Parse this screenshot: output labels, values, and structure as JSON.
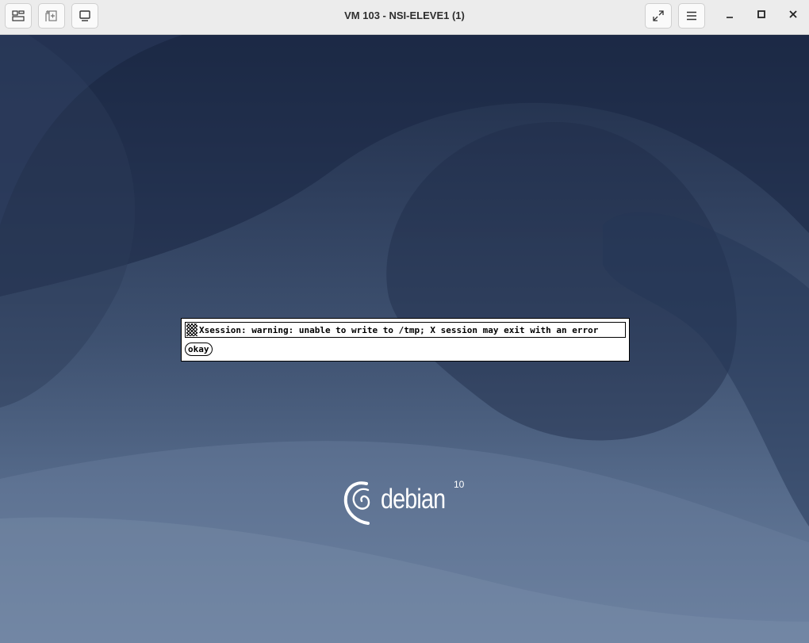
{
  "window": {
    "title": "VM 103 - NSI-ELEVE1 (1)"
  },
  "toolbar": {
    "left_icons": [
      "switch-view-icon",
      "send-key-icon",
      "display-icon"
    ],
    "right_icons": [
      "fullscreen-icon",
      "menu-icon"
    ],
    "window_controls": [
      "minimize-icon",
      "maximize-icon",
      "close-icon"
    ]
  },
  "dialog": {
    "message": "Xsession: warning: unable to write to /tmp; X session may exit with an error",
    "button_label": "okay"
  },
  "branding": {
    "os_name": "debian",
    "version": "10"
  },
  "colors": {
    "titlebar": "#ececec",
    "desktop_top": "#1f2d48",
    "desktop_bottom": "#6b809e",
    "dialog_bg": "#ffffff"
  }
}
